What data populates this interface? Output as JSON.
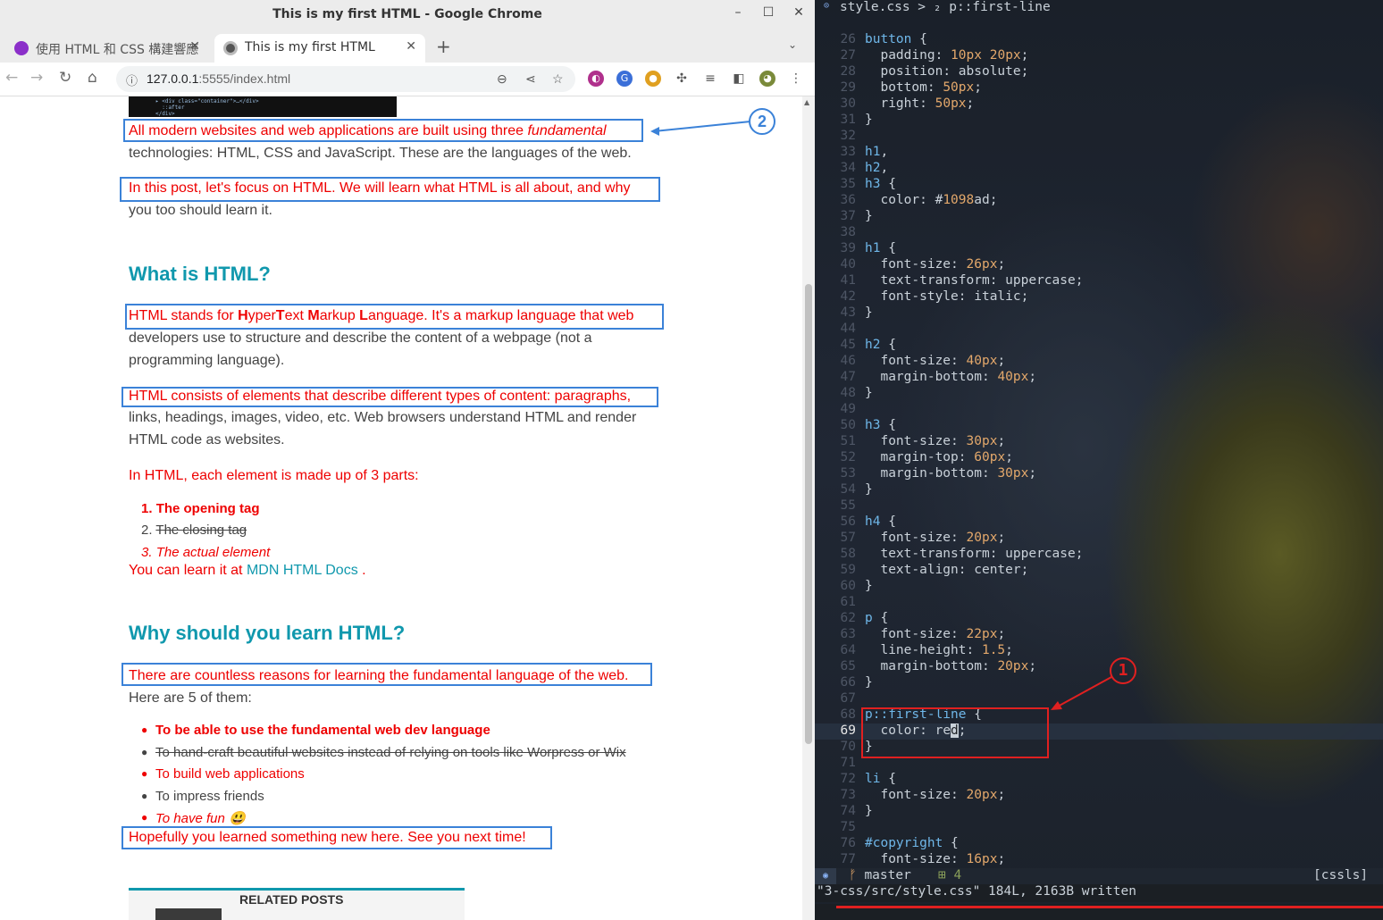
{
  "chrome": {
    "window_title": "This is my first HTML - Google Chrome",
    "tabs": [
      {
        "label": "使用 HTML 和 CSS 構建響應",
        "active": false
      },
      {
        "label": "This is my first HTML",
        "active": true
      }
    ],
    "url_host": "127.0.0.1",
    "url_rest": ":5555/index.html",
    "icons": [
      "back-icon",
      "forward-icon",
      "reload-icon",
      "home-icon",
      "info-icon",
      "zoom-icon",
      "share-icon",
      "star-icon",
      "extensions-icon",
      "menu-icon"
    ]
  },
  "page": {
    "p1_line1_prefix": "All modern websites and web applications are built using three ",
    "p1_line1_em": "fundamental",
    "p1_line2": "technologies: HTML, CSS and JavaScript. These are the languages of the web.",
    "p2_line1": "In this post, let's focus on HTML. We will learn what HTML is all about, and why",
    "p2_line2": "you too should learn it.",
    "h2_what": "What is HTML?",
    "p3_line1": {
      "a": "HTML stands for ",
      "b": "H",
      "c": "yper",
      "d": "T",
      "e": "ext ",
      "f": "M",
      "g": "arkup ",
      "h": "L",
      "i": "anguage. It's a markup language that web"
    },
    "p3_line2": "developers use to structure and describe the content of a webpage (not a",
    "p3_line3": "programming language).",
    "p4_line1": "HTML consists of elements that describe different types of content: paragraphs,",
    "p4_line2": "links, headings, images, video, etc. Web browsers understand HTML and render",
    "p4_line3": "HTML code as websites.",
    "p5_line1": "In HTML, each element is made up of 3 parts:",
    "ol": [
      {
        "num": "1.",
        "text": "The opening tag"
      },
      {
        "num": "2.",
        "text": "The closing tag"
      },
      {
        "num": "3.",
        "text": "The actual element"
      }
    ],
    "p6_prefix": "You can learn it at ",
    "p6_link": "MDN HTML Docs",
    "p6_suffix": " .",
    "h2_why": "Why should you learn HTML?",
    "p7_line1": "There are countless reasons for learning the fundamental language of the web.",
    "p7_line2": "Here are 5 of them:",
    "ul": [
      "To be able to use the fundamental web dev language",
      "To hand-craft beautiful websites instead of relying on tools like Worpress or Wix",
      "To build web applications",
      "To impress friends",
      "To have fun 😃"
    ],
    "p8_line1": "Hopefully you learned something new here. See you next time!",
    "related_title": "RELATED POSTS",
    "annotation_2": "2"
  },
  "nvim": {
    "winbar": "style.css > ₂ p::first-line",
    "lines": [
      {
        "n": "26",
        "t": "button {"
      },
      {
        "n": "27",
        "t": "  padding: 10px 20px;"
      },
      {
        "n": "28",
        "t": "  position: absolute;"
      },
      {
        "n": "29",
        "t": "  bottom: 50px;"
      },
      {
        "n": "30",
        "t": "  right: 50px;"
      },
      {
        "n": "31",
        "t": "}"
      },
      {
        "n": "32",
        "t": ""
      },
      {
        "n": "33",
        "t": "h1,"
      },
      {
        "n": "34",
        "t": "h2,"
      },
      {
        "n": "35",
        "t": "h3 {"
      },
      {
        "n": "36",
        "t": "  color: #1098ad;"
      },
      {
        "n": "37",
        "t": "}"
      },
      {
        "n": "38",
        "t": ""
      },
      {
        "n": "39",
        "t": "h1 {"
      },
      {
        "n": "40",
        "t": "  font-size: 26px;"
      },
      {
        "n": "41",
        "t": "  text-transform: uppercase;"
      },
      {
        "n": "42",
        "t": "  font-style: italic;"
      },
      {
        "n": "43",
        "t": "}"
      },
      {
        "n": "44",
        "t": ""
      },
      {
        "n": "45",
        "t": "h2 {"
      },
      {
        "n": "46",
        "t": "  font-size: 40px;"
      },
      {
        "n": "47",
        "t": "  margin-bottom: 40px;"
      },
      {
        "n": "48",
        "t": "}"
      },
      {
        "n": "49",
        "t": ""
      },
      {
        "n": "50",
        "t": "h3 {"
      },
      {
        "n": "51",
        "t": "  font-size: 30px;"
      },
      {
        "n": "52",
        "t": "  margin-top: 60px;"
      },
      {
        "n": "53",
        "t": "  margin-bottom: 30px;"
      },
      {
        "n": "54",
        "t": "}"
      },
      {
        "n": "55",
        "t": ""
      },
      {
        "n": "56",
        "t": "h4 {"
      },
      {
        "n": "57",
        "t": "  font-size: 20px;"
      },
      {
        "n": "58",
        "t": "  text-transform: uppercase;"
      },
      {
        "n": "59",
        "t": "  text-align: center;"
      },
      {
        "n": "60",
        "t": "}"
      },
      {
        "n": "61",
        "t": ""
      },
      {
        "n": "62",
        "t": "p {"
      },
      {
        "n": "63",
        "t": "  font-size: 22px;"
      },
      {
        "n": "64",
        "t": "  line-height: 1.5;"
      },
      {
        "n": "65",
        "t": "  margin-bottom: 20px;"
      },
      {
        "n": "66",
        "t": "}"
      },
      {
        "n": "67",
        "t": ""
      },
      {
        "n": "68",
        "t": "p::first-line {"
      },
      {
        "n": "69",
        "t": "  color: red;",
        "current": true
      },
      {
        "n": "70",
        "t": "}"
      },
      {
        "n": "71",
        "t": ""
      },
      {
        "n": "72",
        "t": "li {"
      },
      {
        "n": "73",
        "t": "  font-size: 20px;"
      },
      {
        "n": "74",
        "t": "}"
      },
      {
        "n": "75",
        "t": ""
      },
      {
        "n": "76",
        "t": "#copyright {"
      },
      {
        "n": "77",
        "t": "  font-size: 16px;"
      }
    ],
    "status_branch": "master",
    "status_diag": "4",
    "status_lsp": "[cssls]",
    "message": "\"3-css/src/style.css\" 184L, 2163B written",
    "annotation_1": "1"
  },
  "colors": {
    "accent_teal": "#1098ad",
    "first_line_red": "#e00000",
    "annotation_blue": "#3b82d8",
    "annotation_red": "#e02020"
  }
}
